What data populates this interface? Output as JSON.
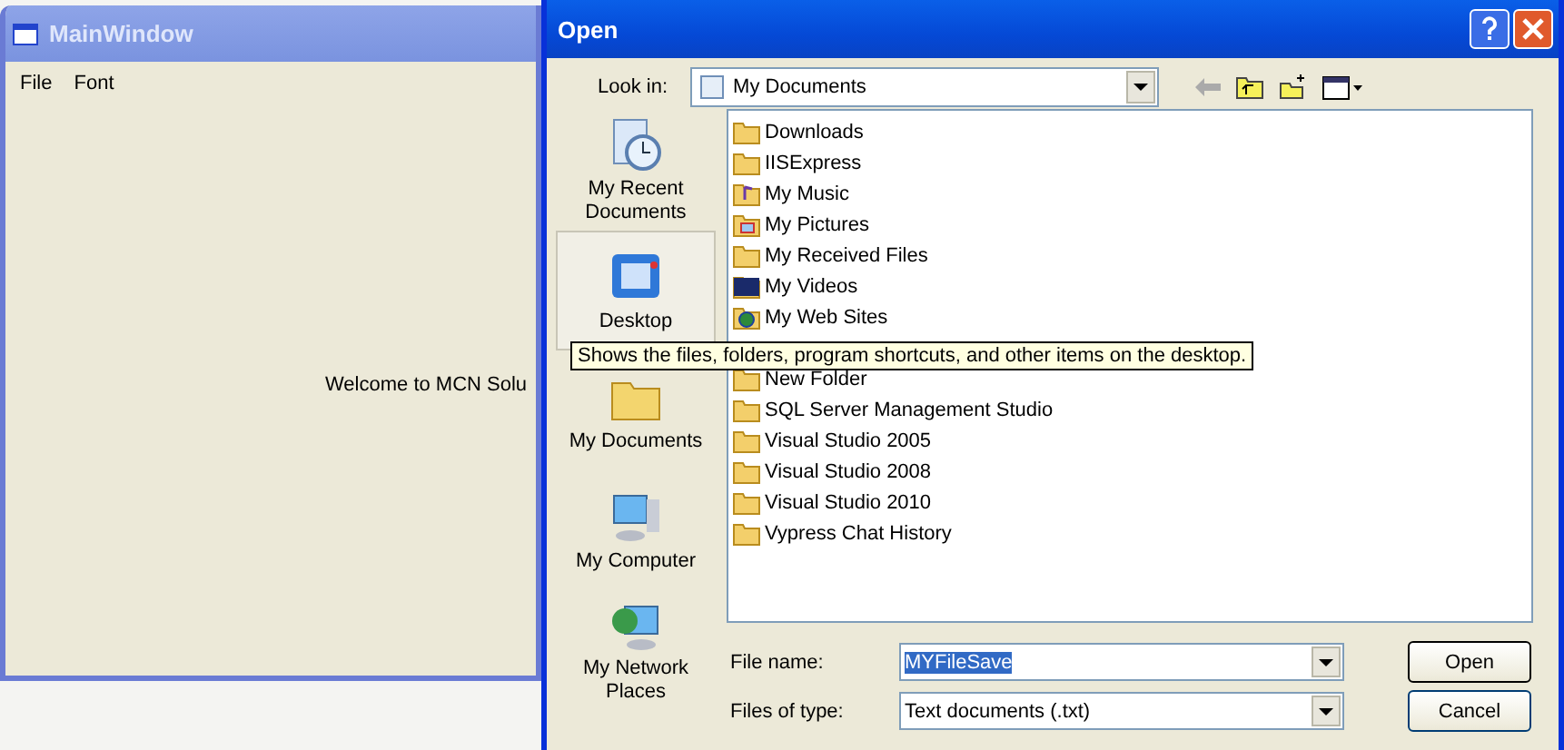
{
  "main_window": {
    "title": "MainWindow",
    "menu": [
      "File",
      "Font"
    ],
    "welcome": "Welcome to MCN Solu"
  },
  "dialog": {
    "title": "Open",
    "look_in": {
      "label": "Look in:",
      "value": "My Documents"
    },
    "places": [
      {
        "label": "My Recent Documents",
        "kind": "recent",
        "selected": false
      },
      {
        "label": "Desktop",
        "kind": "desktop",
        "selected": true
      },
      {
        "label": "My Documents",
        "kind": "documents",
        "selected": false
      },
      {
        "label": "My Computer",
        "kind": "computer",
        "selected": false
      },
      {
        "label": "My Network Places",
        "kind": "network",
        "selected": false
      }
    ],
    "files": [
      {
        "name": "Downloads",
        "kind": "folder"
      },
      {
        "name": "IISExpress",
        "kind": "folder"
      },
      {
        "name": "My Music",
        "kind": "music"
      },
      {
        "name": "My Pictures",
        "kind": "pictures"
      },
      {
        "name": "My Received Files",
        "kind": "folder"
      },
      {
        "name": "My Videos",
        "kind": "videos"
      },
      {
        "name": "My Web Sites",
        "kind": "web"
      },
      {
        "name": "New Folder",
        "kind": "folder",
        "gap": true
      },
      {
        "name": "SQL Server Management Studio",
        "kind": "folder"
      },
      {
        "name": "Visual Studio 2005",
        "kind": "folder"
      },
      {
        "name": "Visual Studio 2008",
        "kind": "folder"
      },
      {
        "name": "Visual Studio 2010",
        "kind": "folder"
      },
      {
        "name": "Vypress Chat History",
        "kind": "folder"
      }
    ],
    "file_name": {
      "label": "File name:",
      "value": "MYFileSave"
    },
    "file_type": {
      "label": "Files of type:",
      "value": "Text documents (.txt)"
    },
    "buttons": [
      "Open",
      "Cancel"
    ],
    "tooltip": "Shows the files, folders, program shortcuts, and other items on the desktop."
  }
}
